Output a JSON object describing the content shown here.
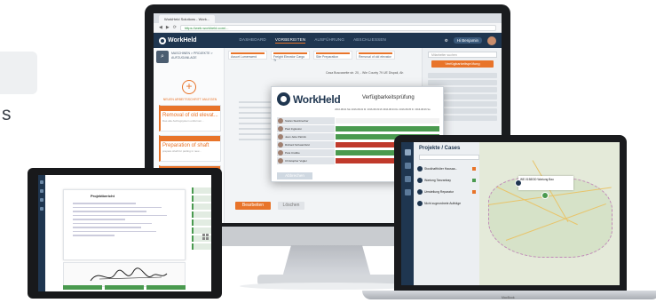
{
  "left_fragment": {
    "letter": "s"
  },
  "desktop": {
    "browser_tab": "WorkHeld Solutions - Work...",
    "url": "https://web.workheld.com/...",
    "app": {
      "logo": "WorkHeld",
      "nav": [
        "DASHBOARD",
        "VORBEREITEN",
        "AUSFÜHRUNG",
        "ABSCHLIESSEN"
      ],
      "user": "Hi Benjamin",
      "breadcrumb": "MASCHINEN > PROJEKTE > AUFZUGANLAGE",
      "add_label": "NEUEN ARBEITSSCHRITT ANLEGEN",
      "categories": [
        "Assort Lumenwerd",
        "Freight Elevator Cargo Tr",
        "Site Preparation",
        "Removal of old elevator"
      ],
      "address": "Casa Buscasette str. 20, - Wie County 79 UE Dispaii, Ah",
      "tasks": [
        {
          "title": "Removal of old elevat...",
          "sub": "Das alte Aufzugsystem entfernen..."
        },
        {
          "title": "Preparation of shaft",
          "sub": "prepare shaft for putting in new..."
        }
      ],
      "right_search_placeholder": "Mitarbeiter suchen",
      "availability_button": "Verfügbarkeitsprüfung",
      "edit_button": "Bearbeiten",
      "delete_button": "Löschen"
    },
    "modal": {
      "logo": "WorkHeld",
      "title": "Verfügbarkeitsprüfung",
      "dates": [
        "2016-08-01 Mo",
        "2016-08-02 Di",
        "2016-08-03 Mi",
        "2016-08-04 Do",
        "2016-08-05 Fr",
        "2016-08-06 Sa"
      ],
      "people": [
        {
          "name": "Stefan Steinbrecher",
          "status_color": "#f2f2f2"
        },
        {
          "name": "Paul Ingleston",
          "status_color": "#4a9a4f"
        },
        {
          "name": "Jean Jette Patrick",
          "status_color": "#4a9a4f"
        },
        {
          "name": "Richard Schwarzfeld",
          "status_color": "#c0392b"
        },
        {
          "name": "Peta Crabbe",
          "status_color": "#4a9a4f"
        },
        {
          "name": "Christopher Vogler",
          "status_color": "#c0392b"
        }
      ],
      "cancel": "Abbrechen"
    }
  },
  "tablet": {
    "doc_title": "Projektbericht"
  },
  "laptop": {
    "title": "Projekte / Cases",
    "cases": [
      {
        "label": "Stockhafthüter Hausaa..."
      },
      {
        "label": "Wartung Tanzanbay"
      },
      {
        "label": "Umstellung Reparatur"
      },
      {
        "label": "Nicht zugeordnete Aufträge"
      }
    ],
    "map_popup": "WE.0158030 Wartung Bau",
    "brand": "MacBook"
  },
  "colors": {
    "brand_navy": "#1f3650",
    "accent_orange": "#e8742a",
    "ok_green": "#4a9a4f",
    "busy_red": "#c0392b"
  }
}
